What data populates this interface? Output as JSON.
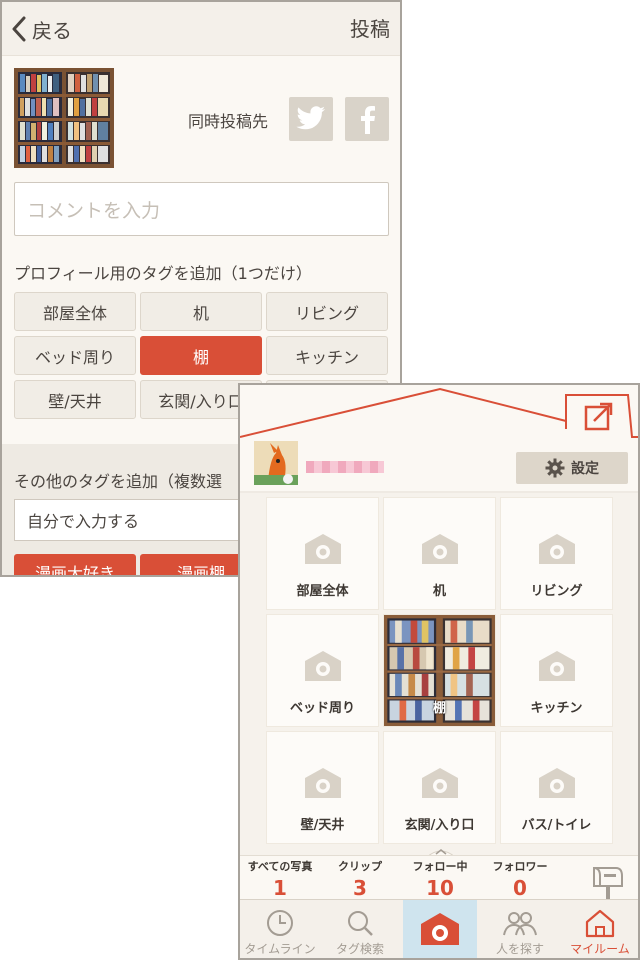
{
  "post_screen": {
    "nav": {
      "back_label": "戻る",
      "post_label": "投稿"
    },
    "share_label": "同時投稿先",
    "comment_placeholder": "コメントを入力",
    "profile_tags_title": "プロフィール用のタグを追加（1つだけ）",
    "profile_tags": [
      {
        "label": "部屋全体",
        "selected": false
      },
      {
        "label": "机",
        "selected": false
      },
      {
        "label": "リビング",
        "selected": false
      },
      {
        "label": "ベッド周り",
        "selected": false
      },
      {
        "label": "棚",
        "selected": true
      },
      {
        "label": "キッチン",
        "selected": false
      },
      {
        "label": "壁/天井",
        "selected": false
      },
      {
        "label": "玄関/入り口",
        "selected": false
      }
    ],
    "other_tags_title": "その他のタグを追加（複数選",
    "other_tags_input": "自分で入力する",
    "other_chips": [
      "漫画大好き",
      "漫画棚"
    ],
    "accent_color": "#d94f37"
  },
  "myroom_screen": {
    "settings_label": "設定",
    "grid": [
      {
        "label": "部屋全体",
        "has_photo": false
      },
      {
        "label": "机",
        "has_photo": false
      },
      {
        "label": "リビング",
        "has_photo": false
      },
      {
        "label": "ベッド周り",
        "has_photo": false
      },
      {
        "label": "棚",
        "has_photo": true
      },
      {
        "label": "キッチン",
        "has_photo": false
      },
      {
        "label": "壁/天井",
        "has_photo": false
      },
      {
        "label": "玄関/入り口",
        "has_photo": false
      },
      {
        "label": "バス/トイレ",
        "has_photo": false
      }
    ],
    "stats": [
      {
        "label": "すべての写真",
        "value": "1"
      },
      {
        "label": "クリップ",
        "value": "3"
      },
      {
        "label": "フォロー中",
        "value": "10"
      },
      {
        "label": "フォロワー",
        "value": "0"
      }
    ],
    "tabs": [
      {
        "label": "タイムライン",
        "icon": "clock-icon"
      },
      {
        "label": "タグ検索",
        "icon": "search-icon"
      },
      {
        "label": "",
        "icon": "camera-house-icon"
      },
      {
        "label": "人を探す",
        "icon": "people-icon"
      },
      {
        "label": "マイルーム",
        "icon": "home-icon"
      }
    ]
  }
}
